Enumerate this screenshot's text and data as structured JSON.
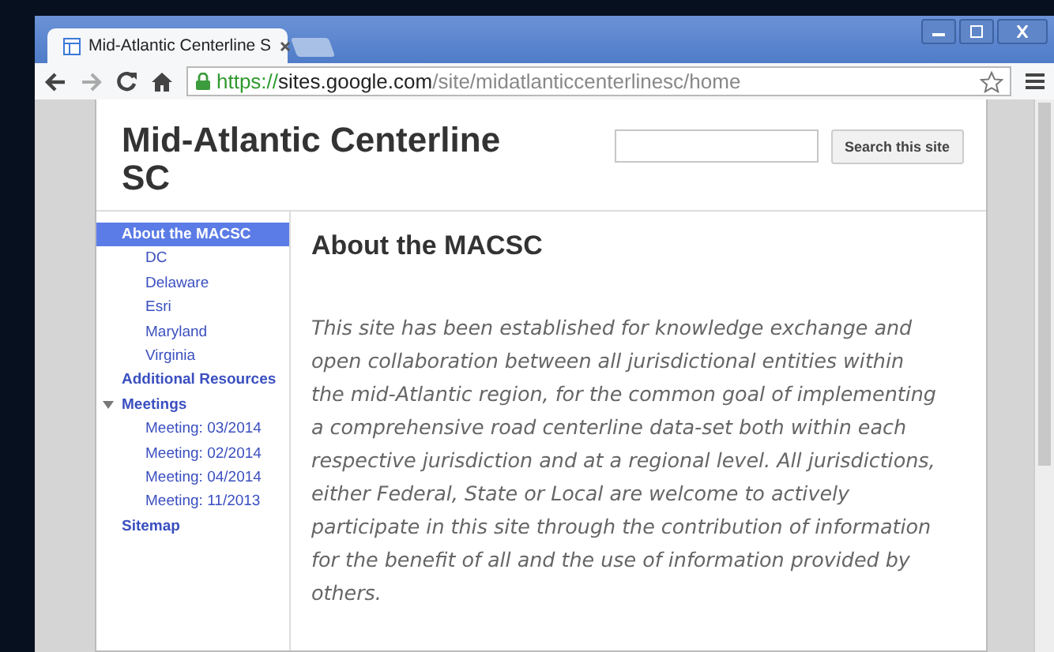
{
  "browser": {
    "tabs": [
      {
        "title": "Mid-Atlantic Centerline S",
        "selected": true
      }
    ],
    "url": {
      "scheme": "https://",
      "host": "sites.google.com",
      "path": "/site/midatlanticcenterlinesc/home"
    }
  },
  "site": {
    "title": "Mid-Atlantic Centerline SC",
    "search": {
      "button": "Search this site"
    }
  },
  "sidebar": {
    "items": [
      {
        "label": "About the MACSC",
        "selected": true,
        "expanded": true,
        "children": [
          {
            "label": "DC",
            "selected": false
          },
          {
            "label": "Delaware",
            "selected": false
          },
          {
            "label": "Esri",
            "selected": false
          },
          {
            "label": "Maryland",
            "selected": false
          },
          {
            "label": "Virginia",
            "selected": false
          }
        ]
      },
      {
        "label": "Additional Resources",
        "selected": false
      },
      {
        "label": "Meetings",
        "selected": false,
        "expanded": true,
        "children": [
          {
            "label": "Meeting: 03/2014",
            "selected": false
          },
          {
            "label": "Meeting: 02/2014",
            "selected": false
          },
          {
            "label": "Meeting: 04/2014",
            "selected": false
          },
          {
            "label": "Meeting: 11/2013",
            "selected": false
          }
        ]
      },
      {
        "label": "Sitemap",
        "selected": false
      }
    ]
  },
  "content": {
    "heading": "About the MACSC",
    "paragraph": "This site has been established for knowledge exchange and open collaboration between all jurisdictional entities within the mid-Atlantic region, for the common goal of implementing a comprehensive road centerline data-set both within each respective jurisdiction and at a regional level.  All jurisdictions, either Federal, State or Local are welcome to actively participate in this site through the contribution of information for the benefit of all and the use of information provided by others."
  }
}
